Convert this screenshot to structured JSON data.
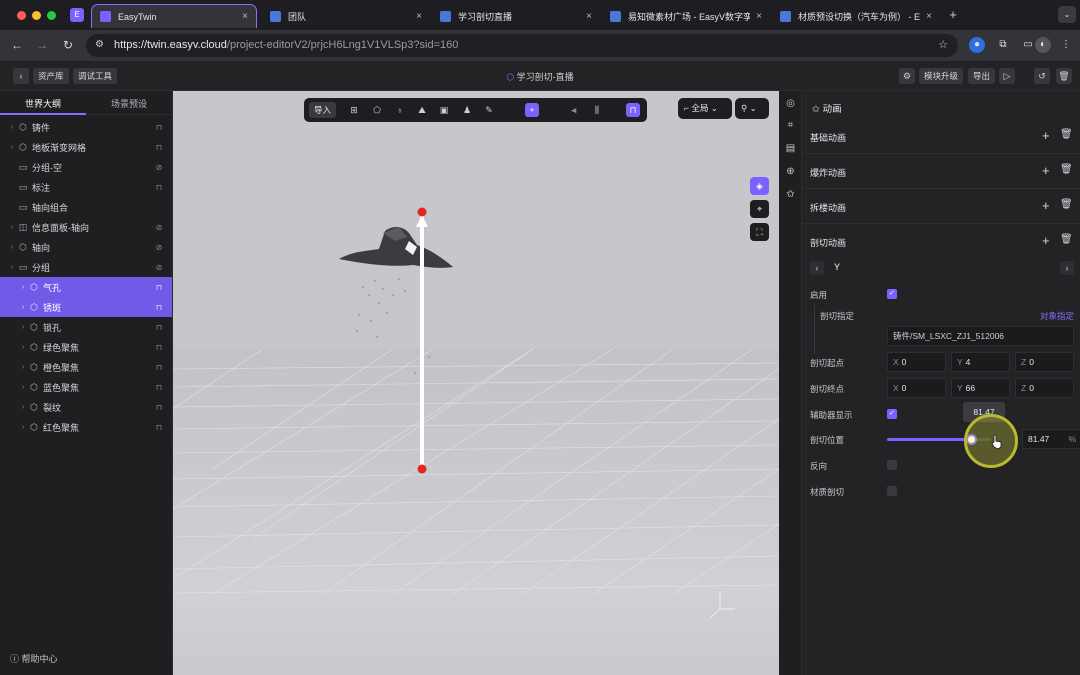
{
  "browser": {
    "app_icon_letter": "E",
    "tabs": [
      {
        "title": "EasyTwin",
        "favicon_color": "#7b61ff"
      },
      {
        "title": "团队",
        "favicon_color": "#4a78d6"
      },
      {
        "title": "学习剖切直播",
        "favicon_color": "#4a78d6"
      },
      {
        "title": "易知微素材广场 - EasyV数字孪",
        "favicon_color": "#4a78d6"
      },
      {
        "title": "材质预设切换（汽车为例） - E",
        "favicon_color": "#4a78d6"
      }
    ],
    "close_glyph": "×",
    "new_tab_glyph": "+",
    "url_host": "https://twin.easyv.cloud",
    "url_path": "/project-editorV2/prjcH6Lng1V1VLSp3?sid=160"
  },
  "header": {
    "asset_lib_label": "资产库",
    "debug_tool_label": "调试工具",
    "project_title": "学习剖切-直播",
    "upgrade_label": "模块升级",
    "export_label": "导出"
  },
  "left_panel": {
    "tabs": [
      "世界大纲",
      "场景预设"
    ],
    "tree": [
      {
        "label": "铸件",
        "icon": "cube",
        "trail": "lock",
        "level": 0,
        "selected": false,
        "arrow": true
      },
      {
        "label": "地板渐变网格",
        "icon": "cube",
        "trail": "lock",
        "level": 0,
        "selected": false,
        "arrow": true
      },
      {
        "label": "分组-空",
        "icon": "folder",
        "trail": "eye-off",
        "level": 0,
        "selected": false,
        "arrow": false
      },
      {
        "label": "标注",
        "icon": "folder",
        "trail": "lock",
        "level": 0,
        "selected": false,
        "arrow": false
      },
      {
        "label": "轴向组合",
        "icon": "folder",
        "trail": "",
        "level": 0,
        "selected": false,
        "arrow": false
      },
      {
        "label": "信息面板-轴向",
        "icon": "panel",
        "trail": "eye-off",
        "level": 0,
        "selected": false,
        "arrow": true
      },
      {
        "label": "轴向",
        "icon": "cube",
        "trail": "eye-off",
        "level": 0,
        "selected": false,
        "arrow": true
      },
      {
        "label": "分组",
        "icon": "folder",
        "trail": "eye-off",
        "level": 0,
        "selected": false,
        "arrow": true
      },
      {
        "label": "气孔",
        "icon": "cube",
        "trail": "lock",
        "level": 1,
        "selected": true,
        "arrow": true
      },
      {
        "label": "锈斑",
        "icon": "cube",
        "trail": "lock",
        "level": 1,
        "selected": true,
        "arrow": true
      },
      {
        "label": "锁孔",
        "icon": "cube",
        "trail": "lock",
        "level": 1,
        "selected": false,
        "arrow": true
      },
      {
        "label": "绿色聚焦",
        "icon": "cube",
        "trail": "lock",
        "level": 1,
        "selected": false,
        "arrow": true
      },
      {
        "label": "橙色聚焦",
        "icon": "cube",
        "trail": "lock",
        "level": 1,
        "selected": false,
        "arrow": true
      },
      {
        "label": "蓝色聚焦",
        "icon": "cube",
        "trail": "lock",
        "level": 1,
        "selected": false,
        "arrow": true
      },
      {
        "label": "裂纹",
        "icon": "cube",
        "trail": "lock",
        "level": 1,
        "selected": false,
        "arrow": true
      },
      {
        "label": "红色聚焦",
        "icon": "cube",
        "trail": "lock",
        "level": 1,
        "selected": false,
        "arrow": true
      }
    ],
    "help_label": "帮助中心"
  },
  "viewport": {
    "import_label": "导入",
    "scope_label": "全局"
  },
  "right_panel": {
    "title": "动画",
    "sections": [
      "基础动画",
      "爆炸动画",
      "拆楼动画",
      "剖切动画"
    ],
    "axis": "Y",
    "enable_label": "启用",
    "enable_checked": true,
    "cut_target_label": "剖切指定",
    "cut_target_link": "对象指定",
    "cut_target_value": "铸件/SM_LSXC_ZJ1_512006",
    "start_label": "剖切起点",
    "start": {
      "x": "0",
      "y": "4",
      "z": "0"
    },
    "end_label": "剖切终点",
    "end": {
      "x": "0",
      "y": "66",
      "z": "0"
    },
    "helper_label": "辅助器显示",
    "helper_checked": true,
    "position_label": "剖切位置",
    "position_value": "81.47",
    "position_percent": 81.47,
    "percent_unit": "%",
    "reverse_label": "反向",
    "reverse_checked": false,
    "material_cut_label": "材质剖切",
    "material_cut_checked": false,
    "tooltip_value": "81.47"
  },
  "colors": {
    "accent": "#7b61ff",
    "marker_red": "#e0281f"
  }
}
